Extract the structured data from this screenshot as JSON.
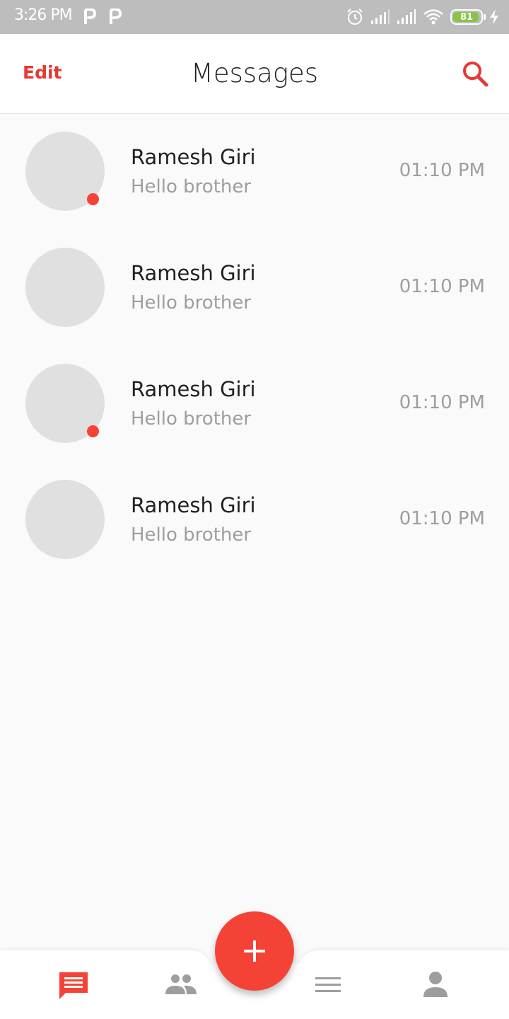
{
  "status_bar": {
    "time": "3:26 PM",
    "battery": "81",
    "icons": [
      "p-notification-icon",
      "p-notification-icon",
      "alarm-icon",
      "signal-icon",
      "signal-icon",
      "wifi-icon",
      "battery-icon",
      "charging-icon"
    ]
  },
  "header": {
    "edit_label": "Edit",
    "title": "Messages",
    "search_icon": "search-icon"
  },
  "conversations": [
    {
      "name": "Ramesh Giri",
      "preview": "Hello brother",
      "time": "01:10 PM",
      "unread": true
    },
    {
      "name": "Ramesh Giri",
      "preview": "Hello brother",
      "time": "01:10 PM",
      "unread": false
    },
    {
      "name": "Ramesh Giri",
      "preview": "Hello brother",
      "time": "01:10 PM",
      "unread": true
    },
    {
      "name": "Ramesh Giri",
      "preview": "Hello brother",
      "time": "01:10 PM",
      "unread": false
    }
  ],
  "bottom_nav": {
    "items": [
      "messages-icon",
      "people-icon",
      "menu-icon",
      "profile-icon"
    ],
    "active": "messages-icon",
    "fab_icon": "plus-icon"
  },
  "colors": {
    "accent": "#f44336",
    "edit_text": "#e53935",
    "status_bar": "#bdbdbd",
    "avatar": "#e0e0e0",
    "secondary_text": "#9e9e9e",
    "nav_inactive": "#9e9e9e",
    "battery_fill": "#8bc34a"
  }
}
